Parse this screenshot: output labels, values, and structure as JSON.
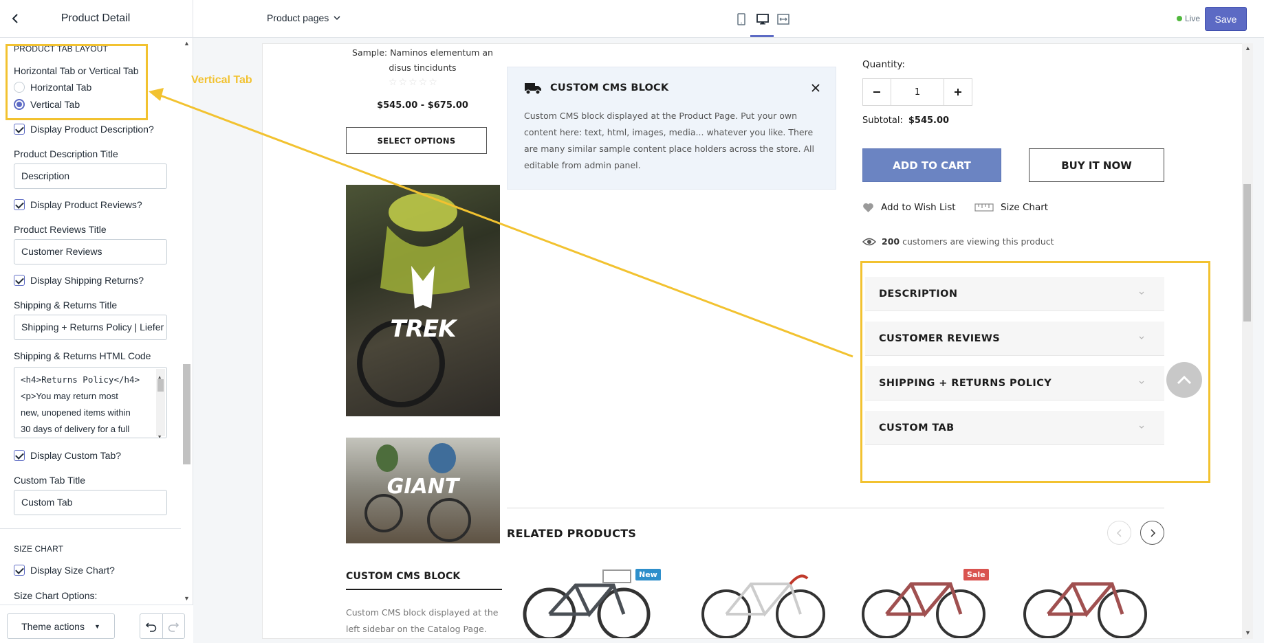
{
  "sidebar": {
    "title": "Product Detail",
    "section_tab_layout": "PRODUCT TAB LAYOUT",
    "tab_layout_label": "Horizontal Tab or Vertical Tab",
    "tab_options": [
      "Horizontal Tab",
      "Vertical Tab"
    ],
    "tab_selected": "Vertical Tab",
    "display_description": "Display Product Description?",
    "description_title_label": "Product Description Title",
    "description_title_value": "Description",
    "display_reviews": "Display Product Reviews?",
    "reviews_title_label": "Product Reviews Title",
    "reviews_title_value": "Customer Reviews",
    "display_shipping": "Display Shipping Returns?",
    "shipping_title_label": "Shipping & Returns Title",
    "shipping_title_value": "Shipping + Returns Policy | Liefer",
    "shipping_html_label": "Shipping & Returns HTML Code",
    "shipping_html_lines": [
      "<h4>Returns Policy</h4>",
      "<p>You may return most",
      "new, unopened items within",
      "30 days of delivery for a full"
    ],
    "display_custom_tab": "Display Custom Tab?",
    "custom_tab_title_label": "Custom Tab Title",
    "custom_tab_title_value": "Custom Tab",
    "section_size_chart": "SIZE CHART",
    "display_size_chart": "Display Size Chart?",
    "size_chart_options_label": "Size Chart Options:",
    "theme_actions": "Theme actions"
  },
  "topbar": {
    "page_selector": "Product pages",
    "live_label": "Live",
    "save_label": "Save"
  },
  "annotation": {
    "label": "Vertical Tab",
    "color": "#f2c230"
  },
  "preview": {
    "product_name": "Sample: Naminos elementum an disus tincidunts",
    "rating": "☆☆☆☆☆",
    "price_range": "$545.00 - $675.00",
    "select_options": "SELECT OPTIONS",
    "banner1_brand": "TREK",
    "banner2_brand": "GIANT",
    "cms_block_title": "CUSTOM CMS BLOCK",
    "cms_block_text": "Custom CMS block displayed at the Product Page. Put your own content here: text, html, images, media... whatever you like. There are many similar sample content place holders across the store. All editable from admin panel.",
    "quantity_label": "Quantity:",
    "quantity_value": "1",
    "subtotal_label": "Subtotal:",
    "subtotal_value": "$545.00",
    "add_to_cart": "ADD TO CART",
    "buy_it_now": "BUY IT NOW",
    "wish_list": "Add to Wish List",
    "size_chart": "Size Chart",
    "viewing_count": "200",
    "viewing_text": "customers are viewing this product",
    "tabs": [
      "DESCRIPTION",
      "CUSTOMER REVIEWS",
      "SHIPPING + RETURNS POLICY",
      "CUSTOM TAB"
    ],
    "related_products_title": "RELATED PRODUCTS",
    "sidebar_cms_title": "CUSTOM CMS BLOCK",
    "sidebar_cms_text": "Custom CMS block displayed at the left sidebar on the Catalog Page. Put",
    "badge_new": "New",
    "badge_sale": "Sale",
    "colors": {
      "accent": "#5c6ac4",
      "add_to_cart": "#6b84c2",
      "badge_new": "#2e8fcb",
      "badge_sale": "#d9534f"
    }
  }
}
